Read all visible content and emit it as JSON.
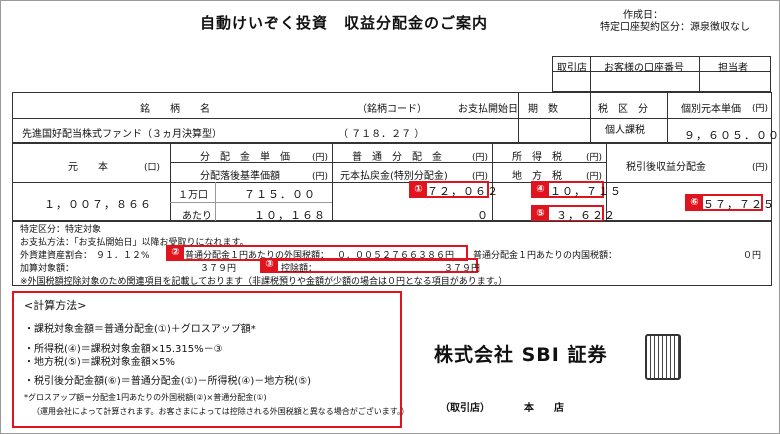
{
  "header": {
    "title": "自動けいぞく投資　収益分配金のご案内",
    "created_label": "作成日：",
    "account_type": "特定口座契約区分：源泉徴収なし"
  },
  "branch_table": {
    "col1": "取引店",
    "col2": "お客様の口座番号",
    "col3": "担当者"
  },
  "fund_table": {
    "h_name": "銘　　柄　　名",
    "h_code": "（銘柄コード）",
    "h_pay_date": "お支払開始日",
    "h_period": "期　数",
    "h_tax_class": "税　区　分",
    "h_unit_price": "個別元本単価",
    "h_unit_price_unit": "(円)",
    "fund_name": "先進国好配当株式ファンド（３ヵ月決算型）",
    "fund_code": "（ ７１８．２７ ）",
    "tax_class": "個人課税",
    "unit_price": "９，６０５．００"
  },
  "dist_table": {
    "h_principal": "元　　本",
    "h_principal_unit": "(口)",
    "h_dist_unit": "分　配　金　単　価",
    "h_dist_unit_u": "(円)",
    "h_base_price": "分配落後基準価額",
    "h_base_price_u": "(円)",
    "h_normal": "普　通　分　配　金",
    "h_normal_u": "(円)",
    "h_refund": "元本払戻金(特別分配金)",
    "h_refund_u": "(円)",
    "h_income_tax": "所　得　税",
    "h_income_tax_u": "(円)",
    "h_local_tax": "地　方　税",
    "h_local_tax_u": "(円)",
    "h_after_tax": "税引後収益分配金",
    "h_after_tax_u": "(円)",
    "principal": "１，００７，８６６",
    "per_label": "１万口",
    "dist_per": "７１５．００",
    "atari_label": "あたり",
    "base_price": "１０，１６８",
    "normal_dist": "７２，０６２",
    "refund": "０",
    "income_tax": "１０，７１５",
    "local_tax": "３，６２２",
    "after_tax": "５７，７２５",
    "b1": "①",
    "b4": "④",
    "b5": "⑤",
    "b6": "⑥"
  },
  "notes": {
    "special": "特定区分：特定対象",
    "payment": "お支払方法：「お支払開始日」以降お受取りになれます。",
    "foreign_ratio_label": "外貨建資産割合：",
    "foreign_ratio_value": "９１．１２%",
    "b2": "②",
    "foreign_tax_label": "普通分配金１円あたりの外国税額：",
    "foreign_tax_value": "０．００５２７６６３８６円",
    "domestic_tax_label": "普通分配金１円あたりの内国税額：",
    "domestic_tax_value": "０円",
    "taxable_label": "加算対象額：",
    "taxable_value": "３７９円",
    "b3": "③",
    "deduct_label": "控除額：",
    "deduct_value": "３７９円",
    "footnote": "※外国税額控除対象のため関連項目を記載しております（非課税預りや金額が少額の場合は０円となる項目があります。）"
  },
  "calc": {
    "title": "<計算方法>",
    "line1": "・課税対象金額＝普通分配金(①)＋グロスアップ額*",
    "line2": "・所得税(④)＝課税対象金額×15.315%－③",
    "line3": "・地方税(⑤)＝課税対象金額×5%",
    "line4": "・税引後分配金額(⑥)＝普通分配金(①)－所得税(④)－地方税(⑤)",
    "line5": "*グロスアップ額＝分配金1円あたりの外国税額(②)×普通分配金(①)",
    "line6": "（運用会社によって計算されます。お客さまによっては控除される外国税額と異なる場合がございます。）"
  },
  "footer": {
    "company": "株式会社 SBI 証券",
    "branch_label": "（取引店）",
    "branch_value": "本　　店"
  }
}
